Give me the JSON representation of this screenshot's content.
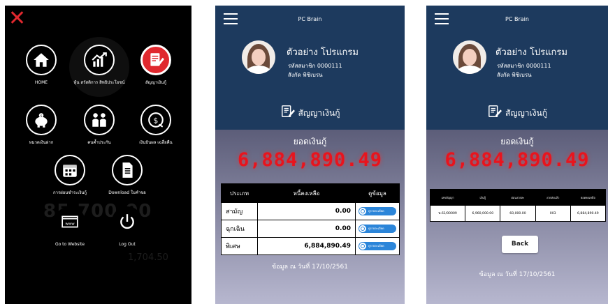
{
  "menu": {
    "ghost_amount": "85,700.00",
    "ghost_value": "1,704.50",
    "items": [
      {
        "label": "HOME",
        "icon": "home-icon"
      },
      {
        "label": "หุ้น สวัสดิการ สิทธิประโยชน์",
        "icon": "stock-chart-icon"
      },
      {
        "label": "สัญญาเงินกู้",
        "icon": "contract-icon"
      },
      {
        "label": "หมวดเงินฝาก",
        "icon": "piggy-bank-icon"
      },
      {
        "label": "คนค้ำประกัน",
        "icon": "guarantor-icon"
      },
      {
        "label": "เงินปันผล เฉลี่ยคืน",
        "icon": "dividend-icon"
      },
      {
        "label": "การผ่อนชำระเงินกู้",
        "icon": "calendar-icon"
      },
      {
        "label": "Download ใบคำขอ",
        "icon": "document-icon"
      },
      {
        "label": "Go to Website",
        "icon": "website-icon"
      },
      {
        "label": "Log Out",
        "icon": "power-icon"
      }
    ],
    "accent": "#e0282e"
  },
  "app": {
    "title": "PC Brain",
    "user_name": "ตัวอย่าง โปรแกรม",
    "member_line": "รหัสสมาชิก 0000111",
    "affiliation": "สังกัด พิชิเบรน",
    "section_title": "สัญญาเงินกู้",
    "balance_label": "ยอดเงินกู้",
    "balance_value": "6,884,890.49",
    "as_of": "ข้อมูล ณ วันที่ 17/10/2561",
    "header_color": "#1d3a5e",
    "balance_color": "#e8141d"
  },
  "loan_table": {
    "headers": [
      "ประเภท",
      "หนี้คงเหลือ",
      "ดูข้อมูล"
    ],
    "rows": [
      {
        "type": "สามัญ",
        "amount": "0.00",
        "button": "ดูรายละเอียด"
      },
      {
        "type": "ฉุกเฉิน",
        "amount": "0.00",
        "button": "ดูรายละเอียด"
      },
      {
        "type": "พิเศษ",
        "amount": "6,884,890.49",
        "button": "ดูรายละเอียด"
      }
    ]
  },
  "contract_table": {
    "headers": [
      "เลขสัญญา",
      "เงินกู้",
      "ผ่อนงวดละ",
      "งวดส่งแล้ว",
      "ยอดคงเหลือ"
    ],
    "rows": [
      [
        "พ.61/00009",
        "6,960,000.00",
        "60,000.00",
        "003",
        "6,884,890.49"
      ]
    ],
    "back_label": "Back"
  }
}
